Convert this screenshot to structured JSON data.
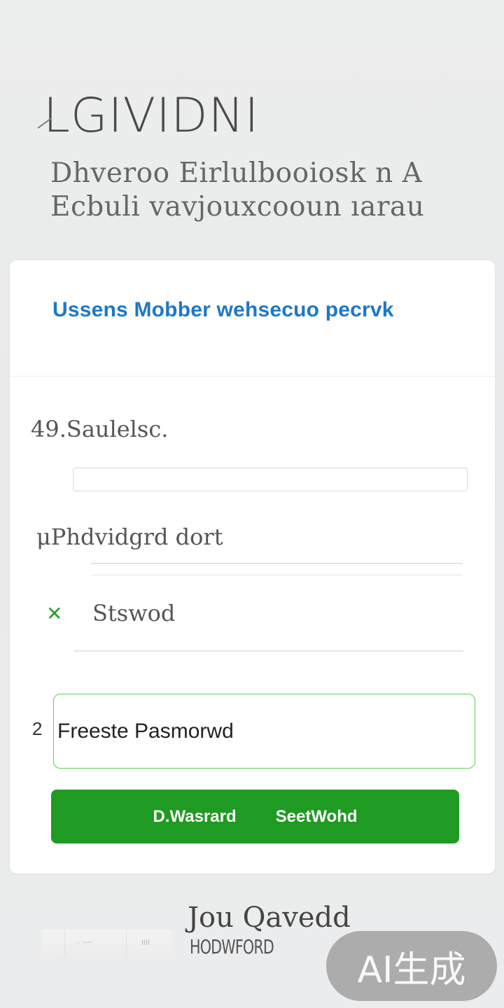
{
  "header": {
    "title": "LGIVIDNI",
    "subtitle_line1": "Dhveroo Eirlulbooiosk n A",
    "subtitle_line2": "Ecbuli vavjouxcooun ıarau"
  },
  "card": {
    "heading": "Ussens Mobber  wehsecuo pecrvk",
    "field1_label": "49.Saulelsc.",
    "field2_label": "μPhdvidgrd dort",
    "option_text": "Stswod",
    "step_number": "2",
    "password_value": "Freeste Pasmorwd",
    "submit_left": "D.Wasrard",
    "submit_right": "SeetWohd"
  },
  "footer": {
    "link1": "Jou Qavedd",
    "link2": "HODWFORD",
    "widget_text1": "·· ~~",
    "widget_text2": "IIII"
  },
  "watermark": "AI生成",
  "colors": {
    "accent_blue": "#1d78c7",
    "accent_green": "#1f9a22",
    "input_border_green": "#5fcf5f"
  },
  "icons": {
    "check": "close-icon"
  }
}
